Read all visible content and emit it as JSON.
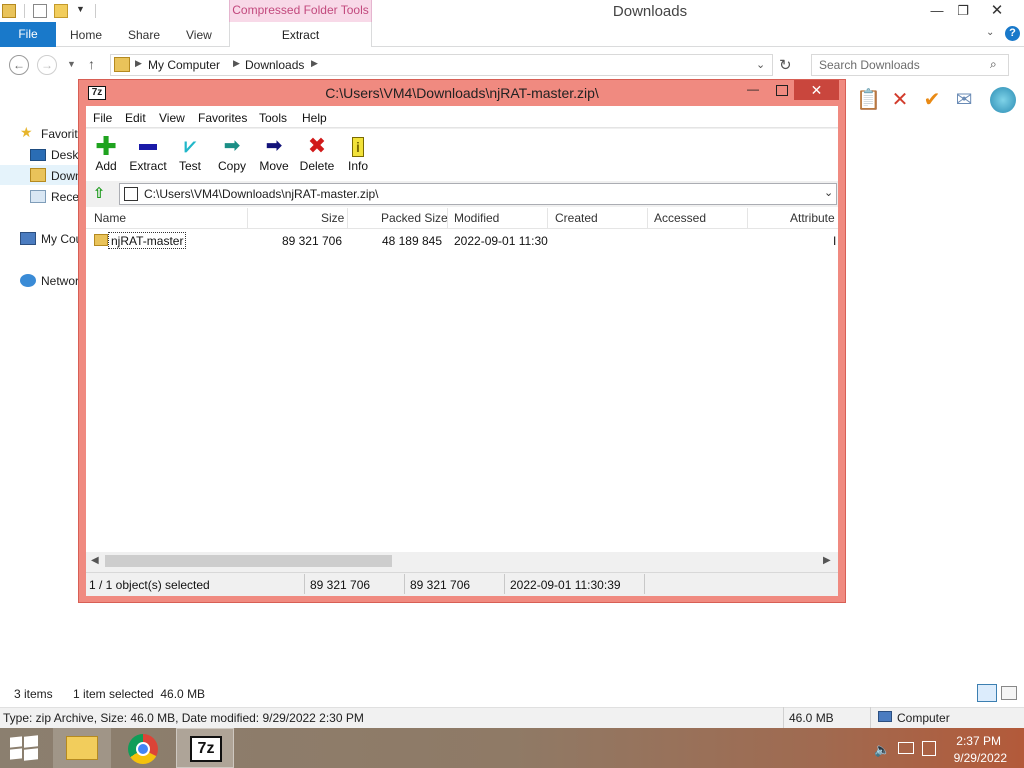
{
  "explorer": {
    "window_title": "Downloads",
    "context_tab_group": "Compressed Folder Tools",
    "ribbon_tabs": [
      "File",
      "Home",
      "Share",
      "View",
      "Extract"
    ],
    "breadcrumb": [
      "My Computer",
      "Downloads"
    ],
    "search_placeholder": "Search Downloads",
    "nav": {
      "favorites": "Favorit",
      "desktop": "Deskt",
      "downloads": "Down",
      "recent": "Recen",
      "computer": "My Cou",
      "network": "Networ"
    },
    "status": {
      "items": "3 items",
      "selected": "1 item selected  46.0 MB"
    },
    "detail_bar": {
      "info": "Type: zip Archive, Size: 46.0 MB, Date modified: 9/29/2022 2:30 PM",
      "size": "46.0 MB",
      "location": "Computer"
    }
  },
  "sevenzip": {
    "title": "C:\\Users\\VM4\\Downloads\\njRAT-master.zip\\",
    "menu": [
      "File",
      "Edit",
      "View",
      "Favorites",
      "Tools",
      "Help"
    ],
    "toolbar": [
      {
        "label": "Add",
        "icon": "plus-icon",
        "color": "#1fa31f"
      },
      {
        "label": "Extract",
        "icon": "minus-icon",
        "color": "#1a1aa8"
      },
      {
        "label": "Test",
        "icon": "check-icon",
        "color": "#21b7c9"
      },
      {
        "label": "Copy",
        "icon": "copy-arrow-icon",
        "color": "#1b8f86"
      },
      {
        "label": "Move",
        "icon": "move-arrow-icon",
        "color": "#13137a"
      },
      {
        "label": "Delete",
        "icon": "x-icon",
        "color": "#d11a1a"
      },
      {
        "label": "Info",
        "icon": "info-icon",
        "color": "#c9b400"
      }
    ],
    "address": "C:\\Users\\VM4\\Downloads\\njRAT-master.zip\\",
    "columns": [
      "Name",
      "Size",
      "Packed Size",
      "Modified",
      "Created",
      "Accessed",
      "Attribute"
    ],
    "rows": [
      {
        "name": "njRAT-master",
        "size": "89 321 706",
        "packed": "48 189 845",
        "modified": "2022-09-01 11:30",
        "attr": "I"
      }
    ],
    "status": {
      "selection": "1 / 1 object(s) selected",
      "size": "89 321 706",
      "packed": "89 321 706",
      "modified": "2022-09-01 11:30:39"
    }
  },
  "taskbar": {
    "time": "2:37 PM",
    "date": "9/29/2022",
    "sevenzip_label": "7z"
  },
  "colors": {
    "file_tab": "#1979ca",
    "context_tab": "#f8d9e8",
    "sevenzip_frame": "#f08a80",
    "taskbar": "#8f7a66"
  }
}
